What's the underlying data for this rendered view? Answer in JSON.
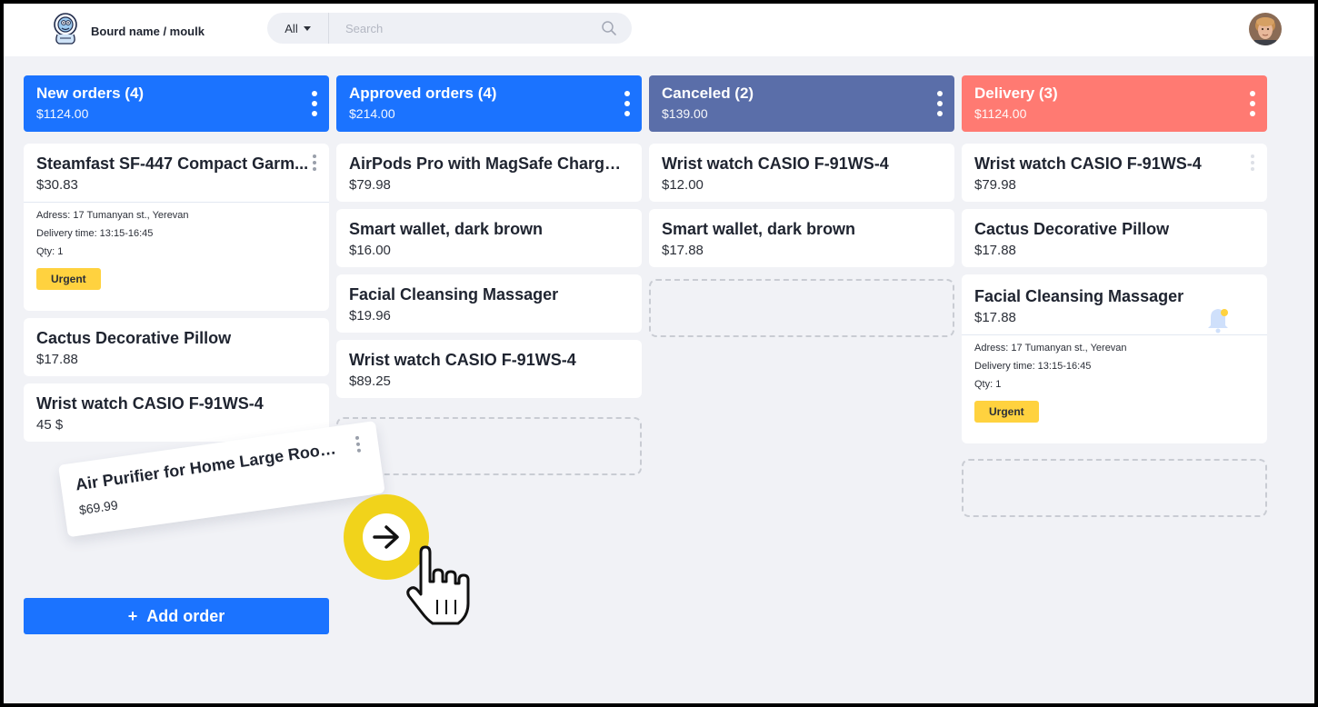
{
  "header": {
    "board_name": "Bourd name / moulk",
    "filter_label": "All",
    "search_placeholder": "Search"
  },
  "columns": [
    {
      "title": "New orders (4)",
      "total": "$1124.00",
      "color": "#1b73ff",
      "cards": [
        {
          "title": "Steamfast SF-447 Compact Garm...",
          "price": "$30.83",
          "address": "Adress: 17 Tumanyan st., Yerevan",
          "delivery": "Delivery time: 13:15-16:45",
          "qty": "Qty: 1",
          "badge": "Urgent"
        },
        {
          "title": "Cactus Decorative Pillow",
          "price": "$17.88"
        },
        {
          "title": "Wrist watch CASIO F-91WS-4",
          "price": "45 $"
        }
      ],
      "add_button": "Add order",
      "add_icon": "+"
    },
    {
      "title": "Approved orders (4)",
      "total": "$214.00",
      "color": "#1b73ff",
      "cards": [
        {
          "title": "AirPods Pro with MagSafe Chargi...",
          "price": "$79.98"
        },
        {
          "title": "Smart wallet, dark brown",
          "price": "$16.00"
        },
        {
          "title": "Facial Cleansing Massager",
          "price": "$19.96"
        },
        {
          "title": "Wrist watch CASIO F-91WS-4",
          "price": "$89.25"
        }
      ]
    },
    {
      "title": "Canceled (2)",
      "total": "$139.00",
      "color": "#5a6ea9",
      "cards": [
        {
          "title": "Wrist watch CASIO F-91WS-4",
          "price": "$12.00"
        },
        {
          "title": "Smart wallet, dark brown",
          "price": "$17.88"
        }
      ]
    },
    {
      "title": "Delivery (3)",
      "total": "$1124.00",
      "color": "#ff7a72",
      "cards": [
        {
          "title": "Wrist watch CASIO F-91WS-4",
          "price": "$79.98"
        },
        {
          "title": "Cactus Decorative Pillow",
          "price": "$17.88"
        },
        {
          "title": "Facial Cleansing Massager",
          "price": "$17.88",
          "address": "Adress: 17 Tumanyan st., Yerevan",
          "delivery": "Delivery time: 13:15-16:45",
          "qty": "Qty: 1",
          "badge": "Urgent"
        }
      ]
    }
  ],
  "dragging_card": {
    "title": "Air Purifier for Home Large Room ...",
    "price": "$69.99"
  },
  "icons": {
    "logo": "mascot-logo-icon",
    "search": "search-icon",
    "avatar": "user-avatar",
    "column_menu": "kebab-menu-icon",
    "move": "arrow-right-icon",
    "cursor": "hand-pointer-icon",
    "notification": "bell-icon"
  },
  "colors": {
    "accent": "#1b73ff",
    "canceled": "#5a6ea9",
    "delivery": "#ff7a72",
    "urgent_badge": "#ffd23f",
    "move_badge": "#f1d31b",
    "board_background": "#f1f2f6"
  }
}
